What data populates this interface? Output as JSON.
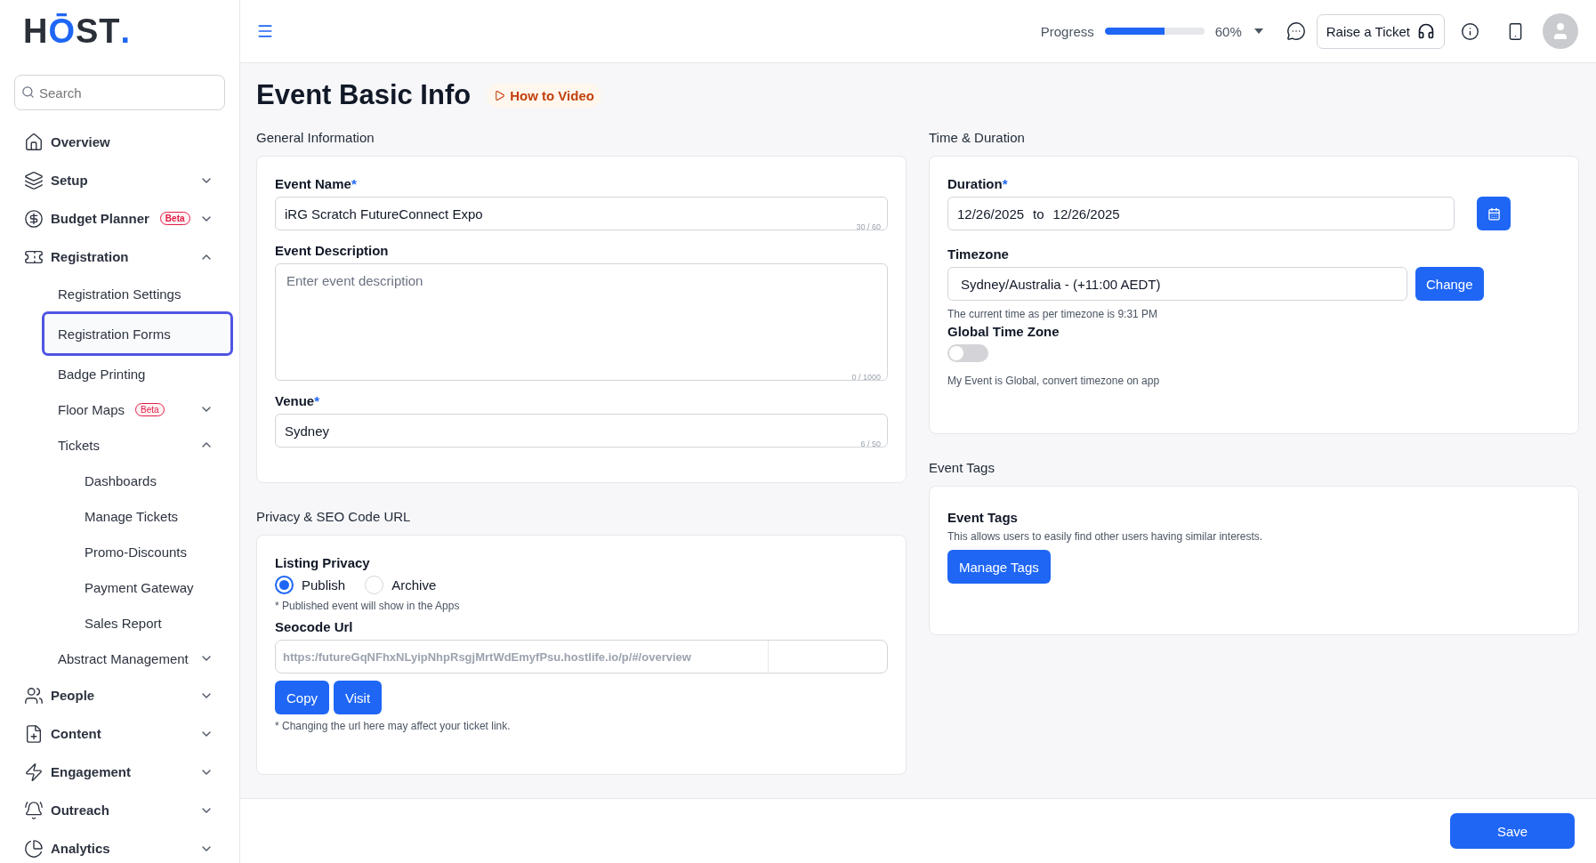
{
  "sidebar": {
    "logo": {
      "start": "H",
      "accent": "Ō",
      "rest": "ST",
      "dot": "."
    },
    "search": {
      "placeholder": "Search"
    },
    "items": [
      {
        "label": "Overview",
        "selected": false
      },
      {
        "label": "Setup",
        "selected": false,
        "expanded": false
      },
      {
        "label": "Budget Planner",
        "badge": "Beta",
        "selected": false,
        "expanded": false
      },
      {
        "label": "Registration",
        "selected": false,
        "expanded": true,
        "children": [
          {
            "label": "Registration Settings",
            "selected": false
          },
          {
            "label": "Registration Forms",
            "selected": true
          },
          {
            "label": "Badge Printing",
            "selected": false
          },
          {
            "label": "Floor Maps",
            "badge": "Beta",
            "selected": false,
            "expanded": false
          },
          {
            "label": "Tickets",
            "selected": false,
            "expanded": true,
            "children": [
              {
                "label": "Dashboards",
                "selected": false
              },
              {
                "label": "Manage Tickets",
                "selected": false
              },
              {
                "label": "Promo-Discounts",
                "selected": false
              },
              {
                "label": "Payment Gateway",
                "selected": false
              },
              {
                "label": "Sales Report",
                "selected": false
              }
            ]
          },
          {
            "label": "Abstract Management",
            "selected": false,
            "expanded": false
          }
        ]
      },
      {
        "label": "People",
        "selected": false,
        "expanded": false
      },
      {
        "label": "Content",
        "selected": false,
        "expanded": false
      },
      {
        "label": "Engagement",
        "selected": false,
        "expanded": false
      },
      {
        "label": "Outreach",
        "selected": false,
        "expanded": false
      },
      {
        "label": "Analytics",
        "selected": false,
        "expanded": false
      }
    ]
  },
  "topbar": {
    "progress": {
      "label": "Progress",
      "level": 0.6,
      "reading": "60%"
    },
    "ticket_button": "Raise a Ticket"
  },
  "page": {
    "title": "Event Basic Info",
    "video_link": "How to Video"
  },
  "general": {
    "heading": "General Information",
    "fields": [
      {
        "kind": "input",
        "label": "Event Name",
        "mark": "*",
        "value": "iRG Scratch FutureConnect Expo",
        "counter": "30 / 60"
      },
      {
        "kind": "textarea",
        "label": "Event Description",
        "placeholder": "Enter event description",
        "counter": "0 / 1000"
      },
      {
        "kind": "input",
        "label": "Venue",
        "mark": "*",
        "value": "Sydney",
        "counter": "6 / 50"
      }
    ]
  },
  "privacy": {
    "heading": "Privacy & SEO Code URL",
    "listing_label": "Listing Privacy",
    "options": [
      {
        "label": "Publish",
        "selected": true
      },
      {
        "label": "Archive",
        "selected": false
      }
    ],
    "note": "* Published event will show in the Apps",
    "url_label": "Seocode Url",
    "url": "https:/futureGqNFhxNLyipNhpRsgjMrtWdEmyfPsu.hostlife.io/p/#/overview",
    "buttons": [
      "Copy",
      "Visit"
    ],
    "url_note": "* Changing the url here may affect your ticket link."
  },
  "time": {
    "heading": "Time & Duration",
    "duration_label": "Duration",
    "mark": "*",
    "start": "12/26/2025",
    "to": "to",
    "end": "12/26/2025",
    "timezone_label": "Timezone",
    "timezone": "Sydney/Australia - (+11:00 AEDT)",
    "change_button": "Change",
    "current_time": "The current time as per timezone is 9:31 PM",
    "global_label": "Global Time Zone",
    "global_on": false,
    "global_note": "My Event is Global, convert timezone on app"
  },
  "tags": {
    "heading": "Event Tags",
    "title": "Event Tags",
    "description": "This allows users to easily find other users having similar interests.",
    "button": "Manage Tags"
  },
  "footer": {
    "save": "Save"
  }
}
